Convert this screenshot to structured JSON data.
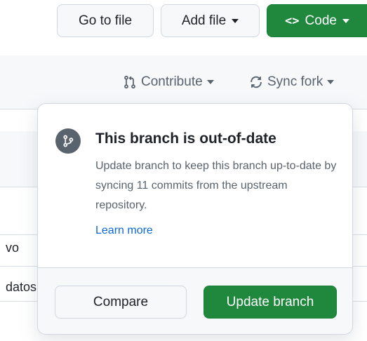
{
  "toolbar": {
    "go_to_file": "Go to file",
    "add_file": "Add file",
    "code": "Code"
  },
  "fork_bar": {
    "contribute": "Contribute",
    "sync_fork": "Sync fork"
  },
  "listing": {
    "rows": [
      "vo",
      "datos"
    ]
  },
  "popover": {
    "title": "This branch is out-of-date",
    "description": "Update branch to keep this branch up-to-date by syncing 11 commits from the upstream repository.",
    "learn_more": "Learn more",
    "compare_button": "Compare",
    "update_button": "Update branch"
  },
  "icons": {
    "code": "code-icon",
    "pull_request": "git-pull-request-icon",
    "sync": "sync-icon",
    "branch": "git-branch-icon"
  },
  "colors": {
    "primary_green": "#1f883d",
    "link_blue": "#0969da",
    "muted_text": "#59636e",
    "border": "#d0d7de"
  }
}
